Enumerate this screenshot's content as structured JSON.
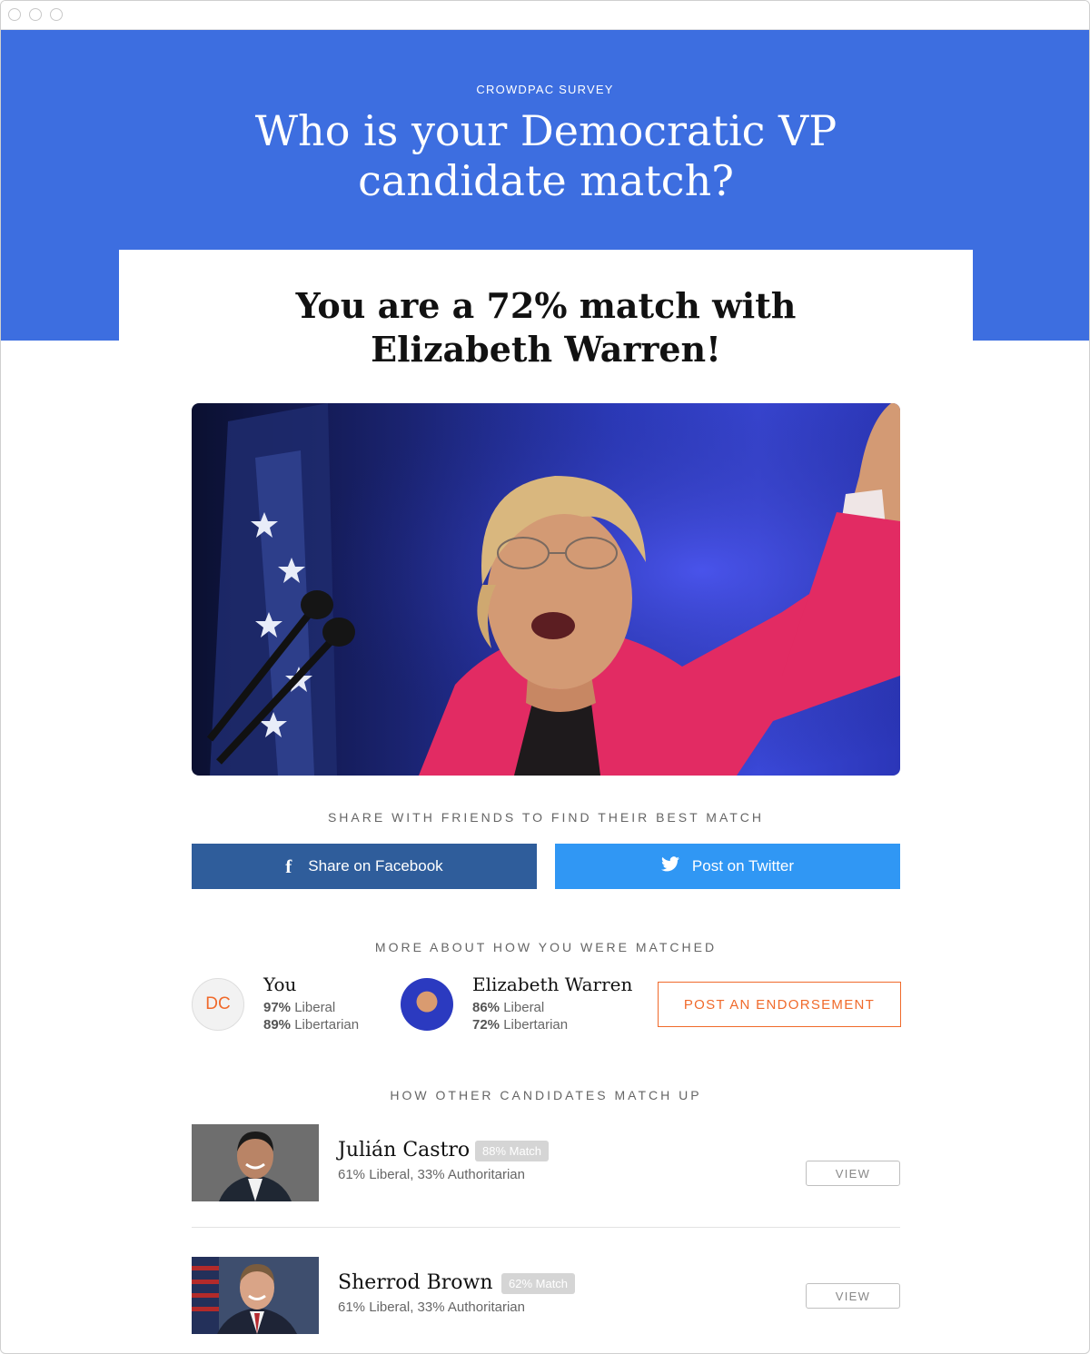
{
  "hero": {
    "eyebrow": "CROWDPAC SURVEY",
    "title_line1": "Who is your Democratic VP",
    "title_line2": "candidate match?"
  },
  "result": {
    "title_line1": "You are a 72% match with",
    "title_line2": "Elizabeth Warren!"
  },
  "share": {
    "label": "SHARE WITH FRIENDS TO FIND THEIR BEST MATCH",
    "facebook_label": "Share on Facebook",
    "twitter_label": "Post on Twitter"
  },
  "matched": {
    "label": "MORE ABOUT HOW YOU WERE MATCHED",
    "you": {
      "initials": "DC",
      "name": "You",
      "liberal_pct": "97%",
      "liberal_label": "Liberal",
      "libertarian_pct": "89%",
      "libertarian_label": "Libertarian"
    },
    "candidate": {
      "name": "Elizabeth Warren",
      "liberal_pct": "86%",
      "liberal_label": "Liberal",
      "libertarian_pct": "72%",
      "libertarian_label": "Libertarian"
    },
    "endorse_label": "POST AN ENDORSEMENT"
  },
  "others": {
    "label": "HOW OTHER CANDIDATES MATCH UP",
    "candidates": [
      {
        "name": "Julián Castro",
        "badge": "88% Match",
        "stats": "61% Liberal, 33% Authoritarian",
        "view_label": "VIEW"
      },
      {
        "name": "Sherrod Brown",
        "badge": "62% Match",
        "stats": "61% Liberal, 33% Authoritarian",
        "view_label": "VIEW"
      }
    ]
  },
  "colors": {
    "brand_blue": "#3d6ee0",
    "facebook": "#2f5d9b",
    "twitter": "#3097f4",
    "accent_orange": "#f06a2b"
  }
}
